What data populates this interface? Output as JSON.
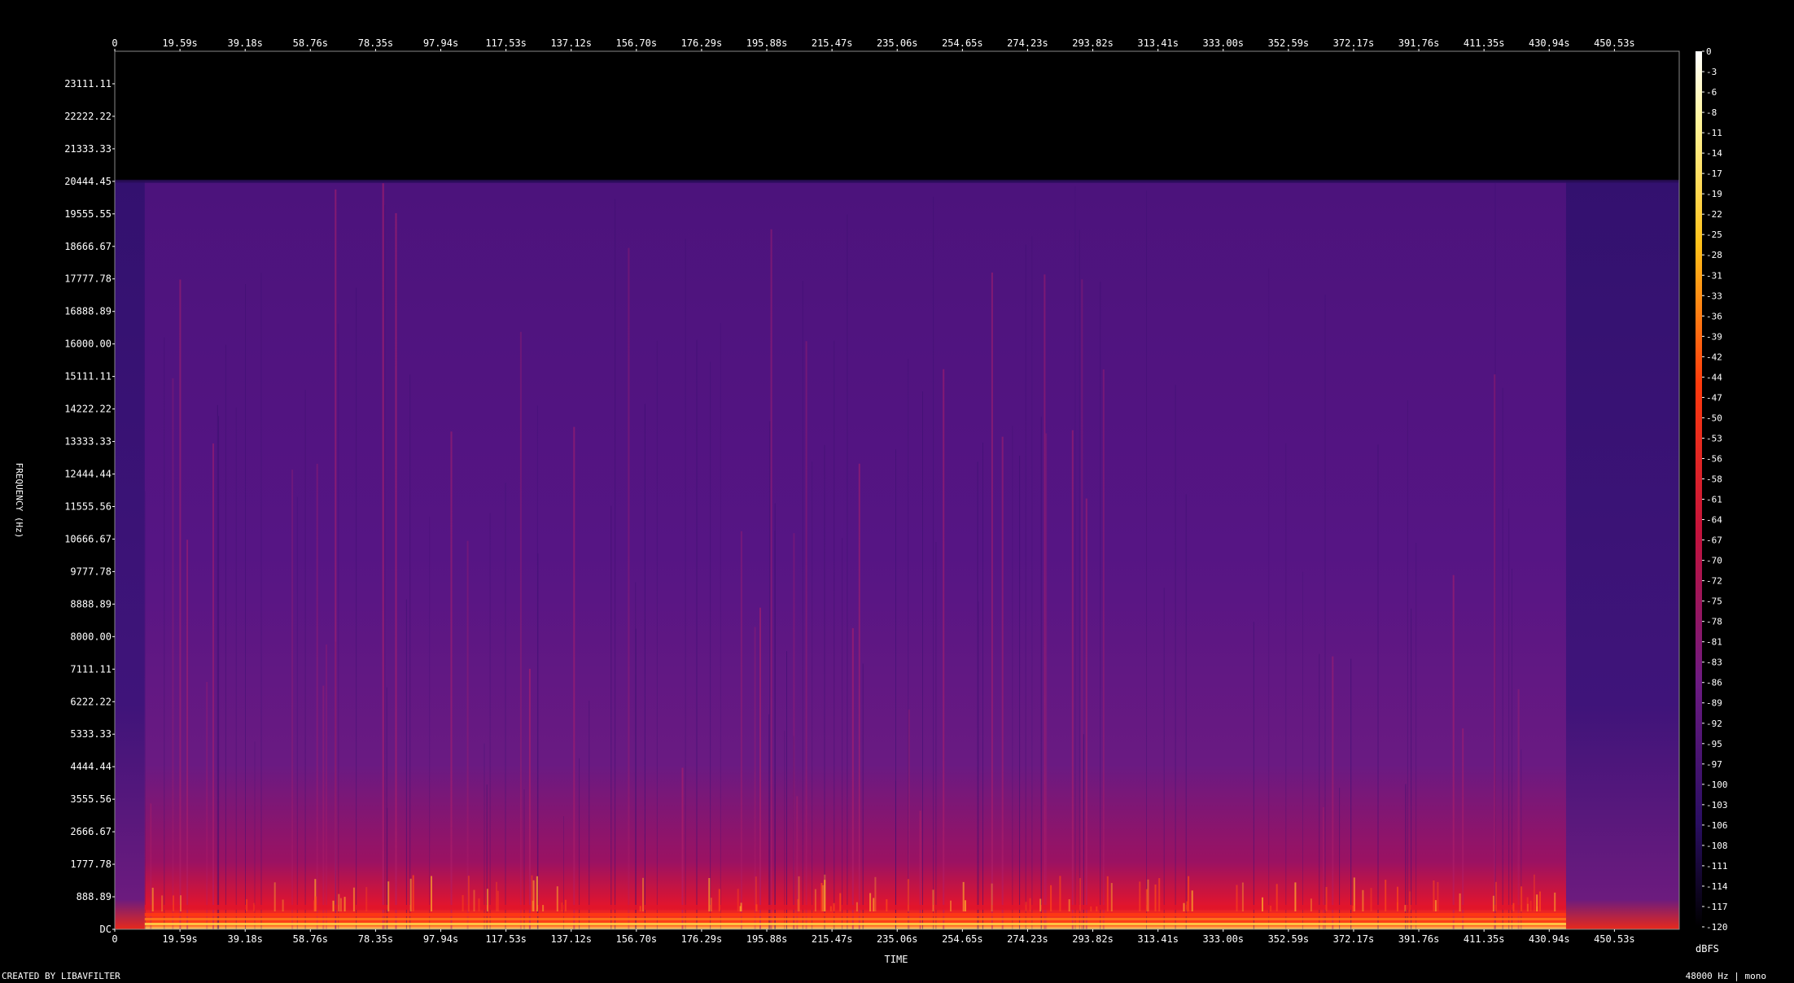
{
  "chart_data": {
    "type": "heatmap",
    "title": "",
    "xlabel": "TIME",
    "ylabel": "FREQUENCY (Hz)",
    "x_ticks": [
      "0",
      "19.59s",
      "39.18s",
      "58.76s",
      "78.35s",
      "97.94s",
      "117.53s",
      "137.12s",
      "156.70s",
      "176.29s",
      "195.88s",
      "215.47s",
      "235.06s",
      "254.65s",
      "274.23s",
      "293.82s",
      "313.41s",
      "333.00s",
      "352.59s",
      "372.17s",
      "391.76s",
      "411.35s",
      "430.94s",
      "450.53s"
    ],
    "y_ticks": [
      "DC",
      "888.89",
      "1777.78",
      "2666.67",
      "3555.56",
      "4444.44",
      "5333.33",
      "6222.22",
      "7111.11",
      "8000.00",
      "8888.89",
      "9777.78",
      "10666.67",
      "11555.56",
      "12444.44",
      "13333.33",
      "14222.22",
      "15111.11",
      "16000.00",
      "16888.89",
      "17777.78",
      "18666.67",
      "19555.55",
      "20444.45",
      "21333.33",
      "22222.22",
      "23111.11"
    ],
    "xlim": [
      0,
      470
    ],
    "ylim": [
      0,
      24000
    ],
    "colorbar": {
      "label": "dBFS",
      "ticks": [
        "0",
        "-3",
        "-6",
        "-8",
        "-11",
        "-14",
        "-17",
        "-19",
        "-22",
        "-25",
        "-28",
        "-31",
        "-33",
        "-36",
        "-39",
        "-42",
        "-44",
        "-47",
        "-50",
        "-53",
        "-56",
        "-58",
        "-61",
        "-64",
        "-67",
        "-70",
        "-72",
        "-75",
        "-78",
        "-81",
        "-83",
        "-86",
        "-89",
        "-92",
        "-95",
        "-97",
        "-100",
        "-103",
        "-106",
        "-108",
        "-111",
        "-114",
        "-117",
        "-120"
      ],
      "range": [
        -120,
        0
      ]
    },
    "content": {
      "signal_start_s": 9,
      "signal_end_s": 436,
      "lowpass_cutoff_hz": 20444,
      "background_level_dbfs": -84,
      "low_band_level_dbfs": -30
    },
    "credit": "CREATED BY LIBAVFILTER",
    "info": "48000 Hz | mono"
  }
}
